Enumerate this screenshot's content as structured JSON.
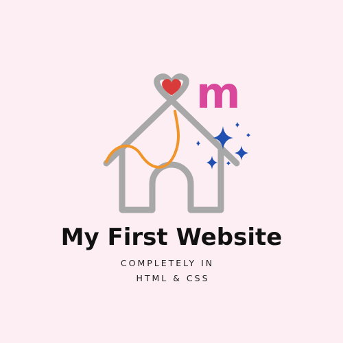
{
  "logo": {
    "letter": "m",
    "colors": {
      "house": "#a8a8a8",
      "heart": "#d93a3a",
      "string": "#f0952a",
      "letter": "#d9489a",
      "sparkles": "#1f4fb0",
      "background": "#fdeef3"
    }
  },
  "title": "My First Website",
  "tagline": {
    "line1": "COMPLETELY IN",
    "line2": "HTML & CSS"
  }
}
